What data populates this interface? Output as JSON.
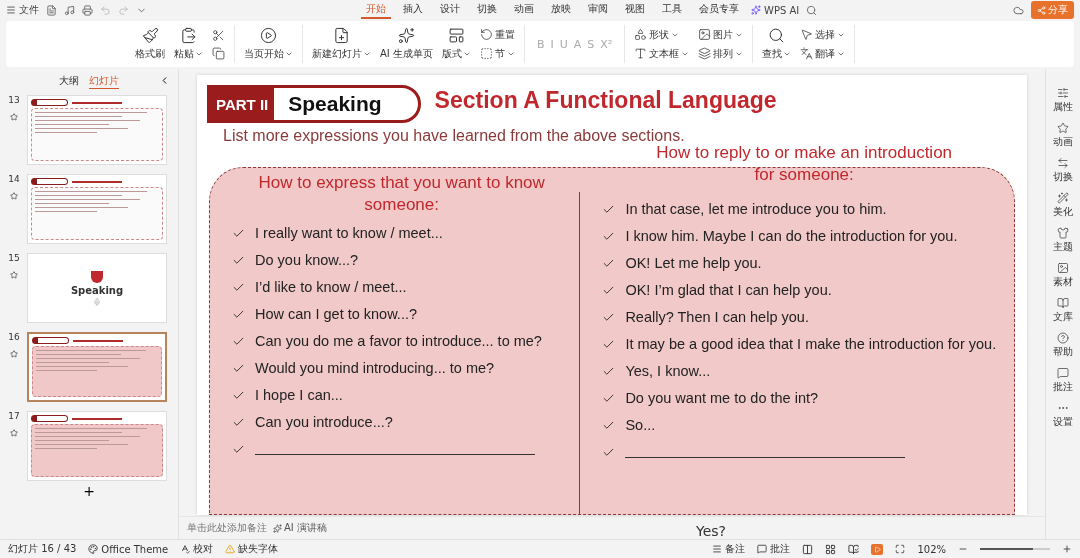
{
  "menu_bar": {
    "file": "文件",
    "tabs": [
      {
        "label": "开始",
        "selected": true
      },
      {
        "label": "插入",
        "selected": false
      },
      {
        "label": "设计",
        "selected": false
      },
      {
        "label": "切换",
        "selected": false
      },
      {
        "label": "动画",
        "selected": false
      },
      {
        "label": "放映",
        "selected": false
      },
      {
        "label": "审阅",
        "selected": false
      },
      {
        "label": "视图",
        "selected": false
      },
      {
        "label": "工具",
        "selected": false
      },
      {
        "label": "会员专享",
        "selected": false
      }
    ],
    "ai": "WPS AI",
    "share": "分享"
  },
  "ribbon": {
    "groups": [
      {
        "items": [
          {
            "kind": "big",
            "label": "格式刷"
          },
          {
            "kind": "big",
            "label": "粘贴",
            "dropdown": true
          },
          {
            "kind": "clipboard"
          }
        ]
      },
      {
        "items": [
          {
            "kind": "big",
            "label": "当页开始",
            "dropdown": true
          }
        ]
      },
      {
        "items": [
          {
            "kind": "big",
            "label": "新建幻灯片",
            "dropdown": true
          },
          {
            "kind": "big",
            "label": "AI 生成单页"
          },
          {
            "kind": "big",
            "label": "版式",
            "dropdown": true
          },
          {
            "kind": "stack",
            "items": [
              {
                "label": "重置"
              },
              {
                "label": "节",
                "dropdown": true
              }
            ]
          }
        ]
      },
      {
        "items": [
          {
            "kind": "fontrow",
            "labels": [
              "B",
              "I",
              "U",
              "A",
              "S",
              "X²"
            ]
          }
        ]
      },
      {
        "items": [
          {
            "kind": "stack",
            "items": [
              {
                "label": "形状",
                "dropdown": true
              },
              {
                "label": "文本框",
                "dropdown": true
              }
            ]
          },
          {
            "kind": "stack",
            "items": [
              {
                "label": "图片",
                "dropdown": true
              },
              {
                "label": "排列",
                "dropdown": true
              }
            ]
          }
        ]
      },
      {
        "items": [
          {
            "kind": "big",
            "label": "查找",
            "dropdown": true
          },
          {
            "kind": "stack",
            "items": [
              {
                "label": "选择",
                "dropdown": true
              },
              {
                "label": "翻译",
                "dropdown": true
              }
            ]
          }
        ]
      }
    ]
  },
  "left_panel": {
    "tabs": [
      {
        "label": "大纲",
        "selected": false
      },
      {
        "label": "幻灯片",
        "selected": true
      }
    ],
    "slides": [
      {
        "number": "13",
        "kind": "quiz",
        "selected": false
      },
      {
        "number": "14",
        "kind": "quiz",
        "selected": false
      },
      {
        "number": "15",
        "kind": "cover",
        "heading": "Speaking",
        "selected": false
      },
      {
        "number": "16",
        "kind": "list",
        "selected": true
      },
      {
        "number": "17",
        "kind": "list",
        "selected": false
      }
    ],
    "add": "+"
  },
  "slide": {
    "part": "PART II",
    "badge": "Speaking",
    "title": "Section A  Functional Language",
    "instruction": "List more expressions you have learned from the above sections.",
    "left": {
      "heading": "How to express that you want to know someone:",
      "items": [
        {
          "kind": "text",
          "text": "I really want to know / meet..."
        },
        {
          "kind": "text",
          "text": "Do you know...?"
        },
        {
          "kind": "text",
          "text": "I’d like to know / meet..."
        },
        {
          "kind": "text",
          "text": "How can I get to know...?"
        },
        {
          "kind": "text",
          "text": "Can you do me a favor to introduce... to me?"
        },
        {
          "kind": "text",
          "text": "Would you mind introducing... to me?"
        },
        {
          "kind": "text",
          "text": "I hope I can..."
        },
        {
          "kind": "text",
          "text": "Can you introduce...?"
        },
        {
          "kind": "blank"
        }
      ]
    },
    "right": {
      "heading": "How to reply to or make an introduction for someone:",
      "items": [
        {
          "kind": "text",
          "text": "In that case, let me introduce you to him."
        },
        {
          "kind": "text",
          "text": "I know him. Maybe I can do the  introduction for you."
        },
        {
          "kind": "text",
          "text": "OK! Let me help you."
        },
        {
          "kind": "text",
          "text": "OK! I’m glad that I can help you."
        },
        {
          "kind": "text",
          "text": "Really? Then I can help you."
        },
        {
          "kind": "text",
          "text": "It may be a good idea that I make the introduction for you."
        },
        {
          "kind": "text",
          "text": "Yes, I know..."
        },
        {
          "kind": "text",
          "text": "Do you want me to do the int?"
        },
        {
          "kind": "text",
          "text": "So..."
        },
        {
          "kind": "blank"
        }
      ]
    }
  },
  "notes": {
    "placeholder": "单击此处添加备注",
    "ai": "AI 演讲稿"
  },
  "overlay_text": "Yes?",
  "right_sidebar": [
    {
      "label": "属性"
    },
    {
      "label": "动画"
    },
    {
      "label": "切换"
    },
    {
      "label": "美化"
    },
    {
      "label": "主题"
    },
    {
      "label": "素材"
    },
    {
      "label": "文库"
    },
    {
      "label": "帮助"
    },
    {
      "label": "批注"
    },
    {
      "label": "设置"
    }
  ],
  "status_bar": {
    "slide": "幻灯片 16 / 43",
    "theme": "Office Theme",
    "proof": "校对",
    "font": "缺失字体",
    "notes": "备注",
    "comments": "批注",
    "zoom": "102%",
    "zoom_slider": {
      "level": 0.75
    }
  }
}
